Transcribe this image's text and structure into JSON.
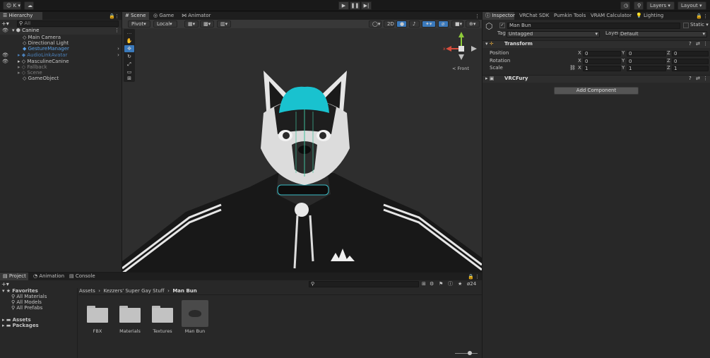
{
  "topbar": {
    "account_label": "K",
    "layers_label": "Layers",
    "layout_label": "Layout",
    "play_icon": "play-icon",
    "pause_icon": "pause-icon",
    "step_icon": "step-icon"
  },
  "hierarchy": {
    "tab": "Hierarchy",
    "search_placeholder": "All",
    "scene": "Canine",
    "items": [
      {
        "label": "Main Camera",
        "style": "normal"
      },
      {
        "label": "Directional Light",
        "style": "normal"
      },
      {
        "label": "GestureManager",
        "style": "blue"
      },
      {
        "label": "AudioLinkAvatar",
        "style": "blue-dim"
      },
      {
        "label": "MasculineCanine",
        "style": "normal"
      },
      {
        "label": "Fallback",
        "style": "dim"
      },
      {
        "label": "Scene",
        "style": "dim"
      },
      {
        "label": "GameObject",
        "style": "normal"
      }
    ]
  },
  "scene_view": {
    "tabs": [
      "Scene",
      "Game",
      "Animator"
    ],
    "pivot_label": "Pivot",
    "local_label": "Local",
    "mode_2d": "2D",
    "gizmo_label": "Front",
    "gizmo_axis_x": "x"
  },
  "inspector": {
    "tabs": [
      "Inspector",
      "VRChat SDK",
      "Pumkin Tools",
      "VRAM Calculator",
      "Lighting"
    ],
    "object_name": "Man Bun",
    "static_label": "Static",
    "tag_label": "Tag",
    "tag_value": "Untagged",
    "layer_label": "Layer",
    "layer_value": "Default",
    "transform_title": "Transform",
    "position_label": "Position",
    "rotation_label": "Rotation",
    "scale_label": "Scale",
    "axis_x": "X",
    "axis_y": "Y",
    "axis_z": "Z",
    "position": [
      "0",
      "0",
      "0"
    ],
    "rotation": [
      "0",
      "0",
      "0"
    ],
    "scale": [
      "1",
      "1",
      "1"
    ],
    "component_title": "VRCFury",
    "add_component": "Add Component"
  },
  "project": {
    "tabs": [
      "Project",
      "Animation",
      "Console"
    ],
    "favorites_label": "Favorites",
    "favorites": [
      "All Materials",
      "All Models",
      "All Prefabs"
    ],
    "assets_label": "Assets",
    "packages_label": "Packages",
    "breadcrumb": [
      "Assets",
      "Kezzers' Super Gay Stuff",
      "Man Bun"
    ],
    "hidden_count": "24",
    "assets": [
      {
        "label": "FBX",
        "type": "folder"
      },
      {
        "label": "Materials",
        "type": "folder"
      },
      {
        "label": "Textures",
        "type": "folder"
      },
      {
        "label": "Man Bun",
        "type": "model"
      }
    ]
  },
  "colors": {
    "accent_blue": "#3a79bb",
    "teal_hair": "#19c2cf",
    "hoodie": "#1a1a1a"
  }
}
